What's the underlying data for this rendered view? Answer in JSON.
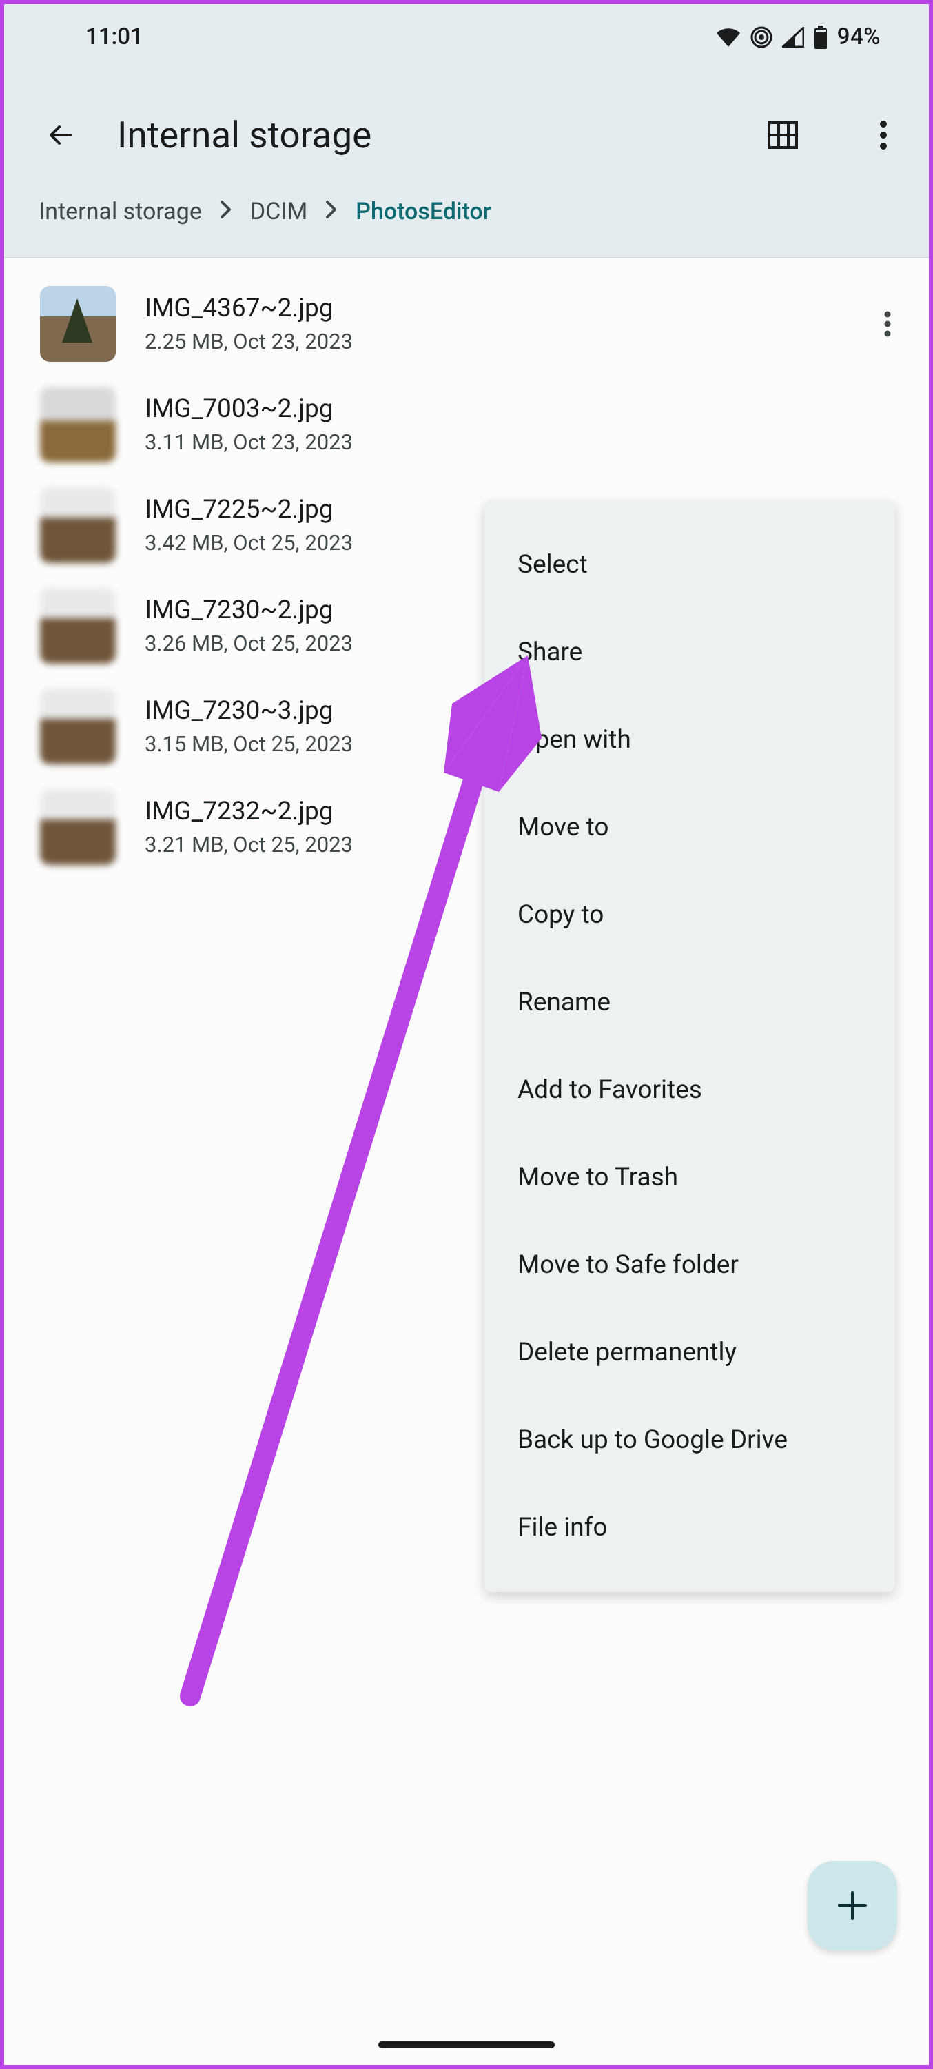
{
  "status": {
    "time": "11:01",
    "battery_pct": "94%"
  },
  "header": {
    "title": "Internal storage"
  },
  "breadcrumb": [
    {
      "label": "Internal storage",
      "active": false
    },
    {
      "label": "DCIM",
      "active": false
    },
    {
      "label": "PhotosEditor",
      "active": true
    }
  ],
  "files": [
    {
      "name": "IMG_4367~2.jpg",
      "meta": "2.25 MB, Oct 23, 2023"
    },
    {
      "name": "IMG_7003~2.jpg",
      "meta": "3.11 MB, Oct 23, 2023"
    },
    {
      "name": "IMG_7225~2.jpg",
      "meta": "3.42 MB, Oct 25, 2023"
    },
    {
      "name": "IMG_7230~2.jpg",
      "meta": "3.26 MB, Oct 25, 2023"
    },
    {
      "name": "IMG_7230~3.jpg",
      "meta": "3.15 MB, Oct 25, 2023"
    },
    {
      "name": "IMG_7232~2.jpg",
      "meta": "3.21 MB, Oct 25, 2023"
    }
  ],
  "context_menu": {
    "items": [
      "Select",
      "Share",
      "Open with",
      "Move to",
      "Copy to",
      "Rename",
      "Add to Favorites",
      "Move to Trash",
      "Move to Safe folder",
      "Delete permanently",
      "Back up to Google Drive",
      "File info"
    ]
  },
  "annotation": {
    "arrow_color": "#b844e6"
  }
}
